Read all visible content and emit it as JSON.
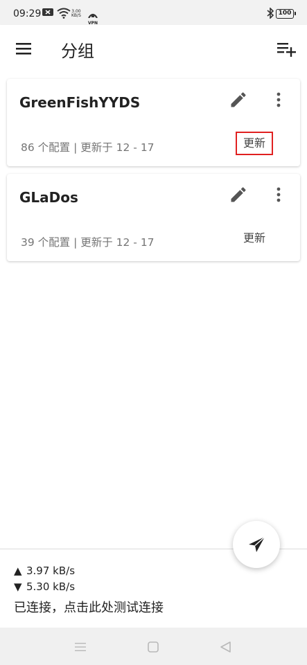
{
  "status_bar": {
    "time": "09:29",
    "net_speed_value": "3.00",
    "net_speed_unit": "KB/S",
    "vpn_label": "VPN",
    "battery": "100"
  },
  "app_bar": {
    "title": "分组",
    "menu_icon": "hamburger-menu-icon",
    "add_icon": "playlist-add-icon"
  },
  "groups": [
    {
      "name": "GreenFishYYDS",
      "meta": "86 个配置 | 更新于 12 - 17",
      "update_label": "更新",
      "highlighted": true
    },
    {
      "name": "GLaDos",
      "meta": "39 个配置 | 更新于 12 - 17",
      "update_label": "更新",
      "highlighted": false
    }
  ],
  "fab": {
    "icon": "send-paper-plane-icon"
  },
  "traffic": {
    "upload": "3.97 kB/s",
    "download": "5.30 kB/s",
    "status": "已连接，点击此处测试连接"
  },
  "colors": {
    "highlight_box": "#e02020",
    "meta_text": "#757575",
    "icon_gray": "#555555"
  }
}
